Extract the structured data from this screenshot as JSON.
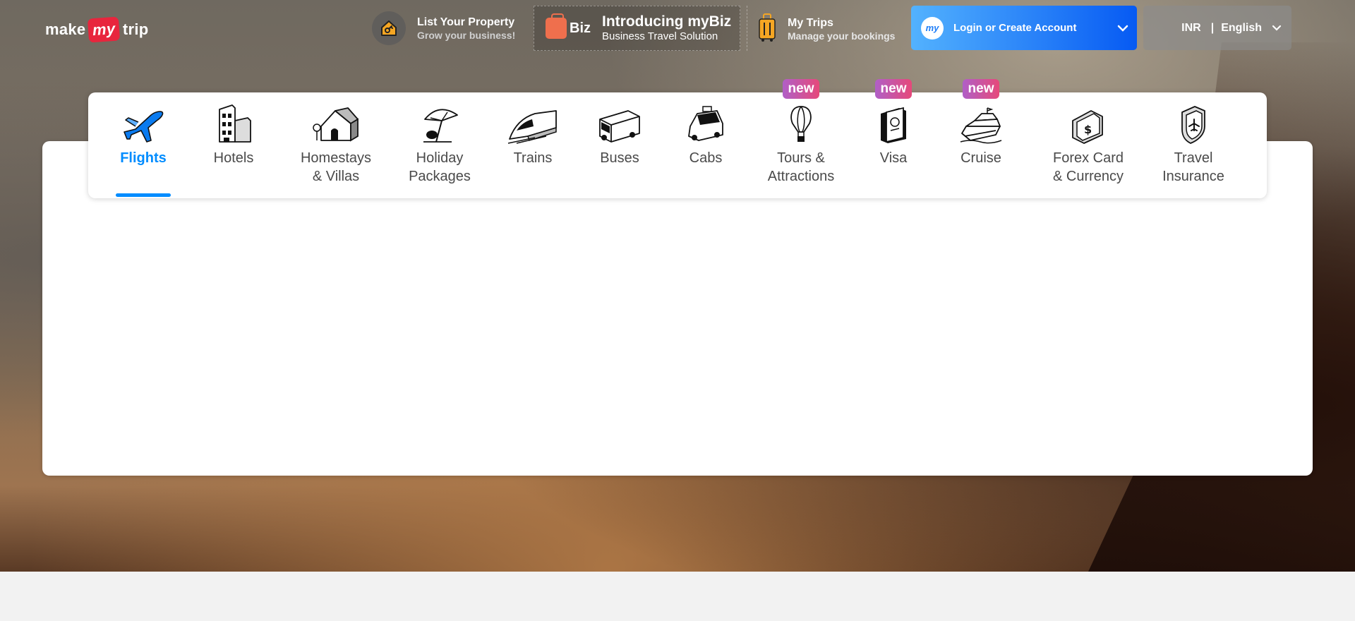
{
  "brand": {
    "pre": "make",
    "mid": "my",
    "post": "trip"
  },
  "header": {
    "list_property": {
      "title": "List Your Property",
      "subtitle": "Grow your business!",
      "icon": "house-key-icon"
    },
    "mybiz": {
      "badge": "Biz",
      "title": "Introducing myBiz",
      "subtitle": "Business Travel Solution",
      "icon": "briefcase-icon"
    },
    "my_trips": {
      "title": "My Trips",
      "subtitle": "Manage your bookings",
      "icon": "suitcase-icon"
    },
    "login": {
      "label": "Login or Create Account",
      "avatar": "my"
    },
    "locale": {
      "currency": "INR",
      "separator": "|",
      "language": "English"
    }
  },
  "nav": {
    "badge_text": "new",
    "items": [
      {
        "label": "Flights",
        "icon": "plane-icon",
        "active": true
      },
      {
        "label": "Hotels",
        "icon": "building-icon"
      },
      {
        "label_1": "Homestays",
        "label_2": "& Villas",
        "icon": "house-icon"
      },
      {
        "label_1": "Holiday",
        "label_2": "Packages",
        "icon": "beach-umbrella-icon"
      },
      {
        "label": "Trains",
        "icon": "train-icon"
      },
      {
        "label": "Buses",
        "icon": "bus-icon"
      },
      {
        "label": "Cabs",
        "icon": "car-icon"
      },
      {
        "label_1": "Tours &",
        "label_2": "Attractions",
        "icon": "hot-air-balloon-icon",
        "badge": true
      },
      {
        "label": "Visa",
        "icon": "passport-icon",
        "badge": true
      },
      {
        "label": "Cruise",
        "icon": "ship-icon",
        "badge": true
      },
      {
        "label_1": "Forex Card",
        "label_2": "& Currency",
        "icon": "forex-card-icon"
      },
      {
        "label_1": "Travel",
        "label_2": "Insurance",
        "icon": "insurance-shield-icon"
      }
    ]
  },
  "colors": {
    "accent": "#008cff",
    "brand_red": "#e8253d",
    "badge_gradient": [
      "#b05fc7",
      "#e6497a"
    ]
  }
}
